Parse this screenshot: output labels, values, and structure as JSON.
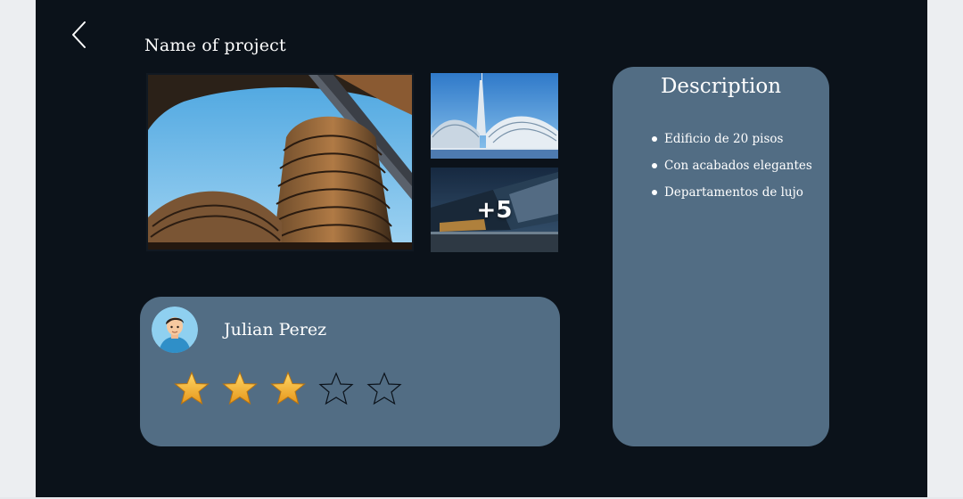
{
  "header": {
    "back_icon": "chevron-left-icon",
    "title": "Name of project"
  },
  "gallery": {
    "images": [
      "main-building-photo",
      "tower-photo",
      "modern-building-photo"
    ],
    "more_count_label": "+5"
  },
  "author": {
    "avatar_icon": "user-avatar-icon",
    "name": "Julian Perez",
    "rating": 3,
    "rating_max": 5
  },
  "description": {
    "title": "Description",
    "items": [
      "Edificio de 20 pisos",
      "Con acabados elegantes",
      "Departamentos de lujo"
    ]
  },
  "colors": {
    "background": "#0b121a",
    "card": "#526d84",
    "text": "#ffffff",
    "star_filled": "#f1b62c"
  }
}
